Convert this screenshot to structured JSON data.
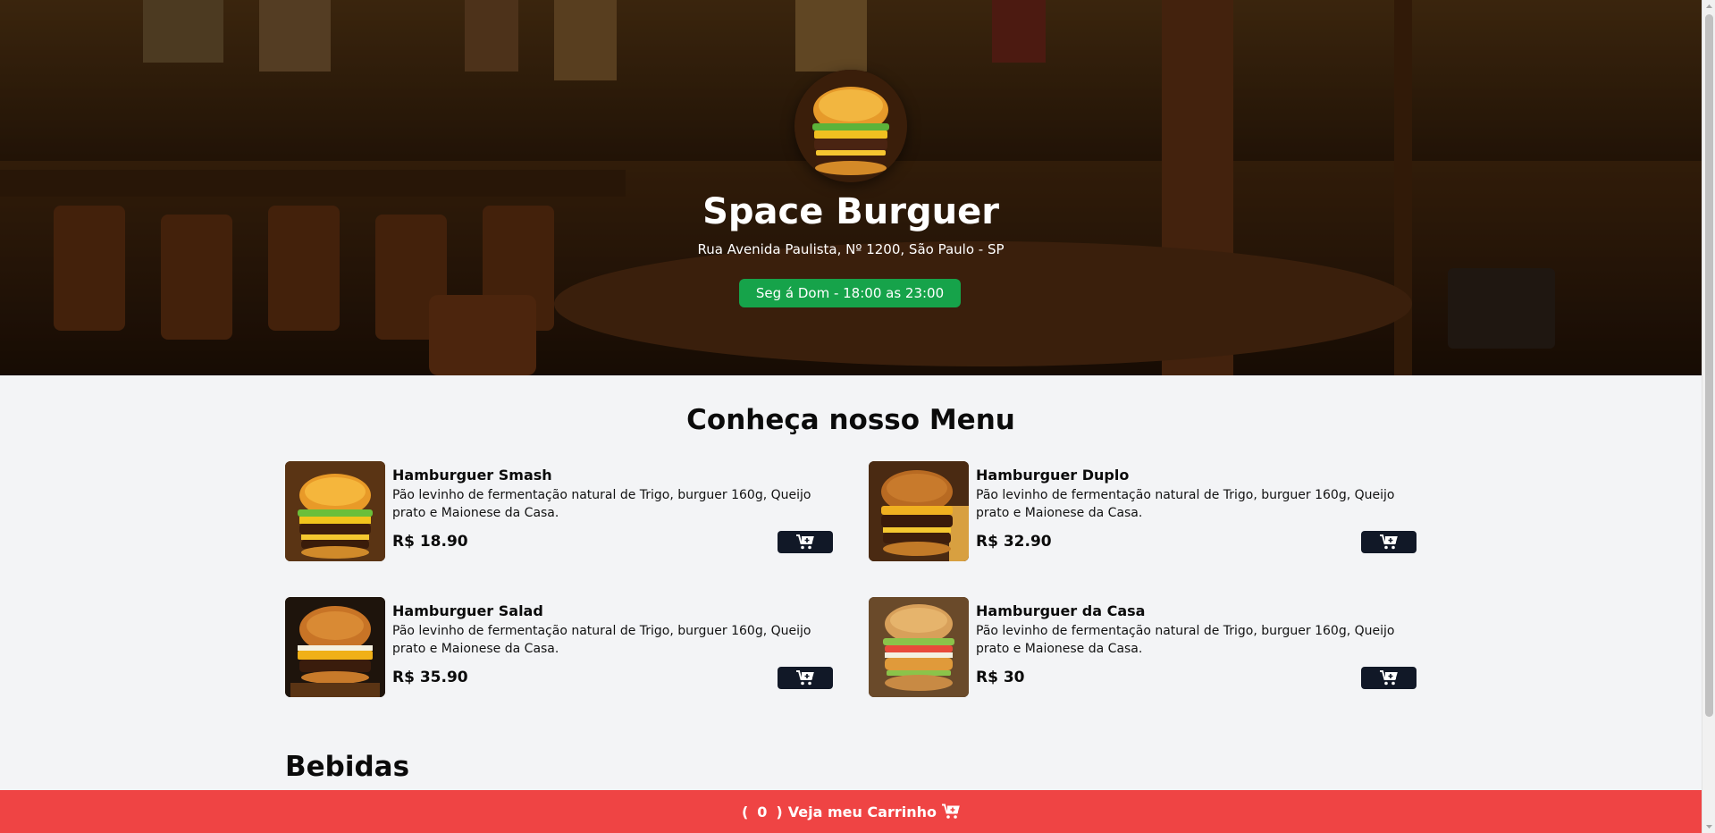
{
  "hero": {
    "title": "Space Burguer",
    "address": "Rua Avenida Paulista, Nº 1200, São Paulo - SP",
    "hours": "Seg á Dom - 18:00 as 23:00"
  },
  "menu": {
    "title": "Conheça nosso Menu",
    "items": [
      {
        "name": "Hamburguer Smash",
        "description": "Pão levinho de fermentação natural de Trigo, burguer 160g, Queijo prato e Maionese da Casa.",
        "price": "R$ 18.90"
      },
      {
        "name": "Hamburguer Duplo",
        "description": "Pão levinho de fermentação natural de Trigo, burguer 160g, Queijo prato e Maionese da Casa.",
        "price": "R$ 32.90"
      },
      {
        "name": "Hamburguer Salad",
        "description": "Pão levinho de fermentação natural de Trigo, burguer 160g, Queijo prato e Maionese da Casa.",
        "price": "R$ 35.90"
      },
      {
        "name": "Hamburguer da Casa",
        "description": "Pão levinho de fermentação natural de Trigo, burguer 160g, Queijo prato e Maionese da Casa.",
        "price": "R$ 30"
      }
    ]
  },
  "drinks": {
    "title": "Bebidas"
  },
  "cart": {
    "open_paren": "(",
    "count": "0",
    "close_paren": ")",
    "label": "Veja meu Carrinho"
  },
  "icons": {
    "cart": "cart-plus-icon",
    "cart_bar": "shopping-cart-icon"
  },
  "colors": {
    "hours_badge": "#16a34a",
    "cart_bar": "#ef4444",
    "add_button": "#111827",
    "page_bg": "#f3f4f6"
  }
}
